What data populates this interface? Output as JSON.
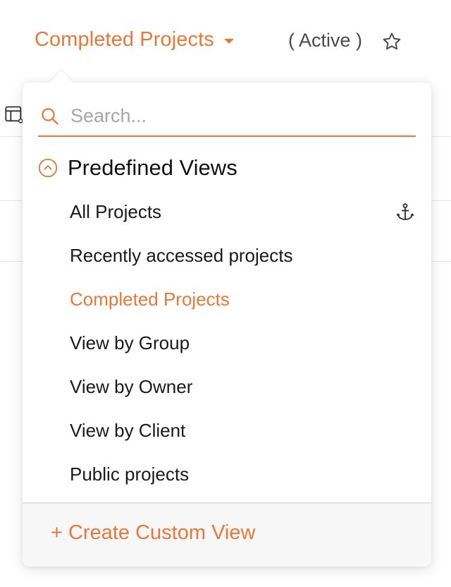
{
  "header": {
    "title": "Completed Projects",
    "status": "( Active )"
  },
  "icons": {
    "caret": "caret-down-icon",
    "star": "star-outline-icon",
    "search": "search-icon",
    "collapse": "chevron-up-circle-icon",
    "anchor": "anchor-icon",
    "table_settings": "table-settings-icon"
  },
  "search": {
    "placeholder": "Search...",
    "value": ""
  },
  "section": {
    "title": "Predefined Views"
  },
  "views": [
    {
      "label": "All Projects",
      "default": true
    },
    {
      "label": "Recently accessed projects"
    },
    {
      "label": "Completed Projects",
      "active": true
    },
    {
      "label": "View by Group"
    },
    {
      "label": "View by Owner"
    },
    {
      "label": "View by Client"
    },
    {
      "label": "Public projects"
    }
  ],
  "footer": {
    "create_label": "+ Create Custom View"
  },
  "colors": {
    "accent": "#e8783a",
    "text": "#1a1a1a",
    "muted": "#a6a6a6",
    "footer_bg": "#f7f7f7"
  }
}
